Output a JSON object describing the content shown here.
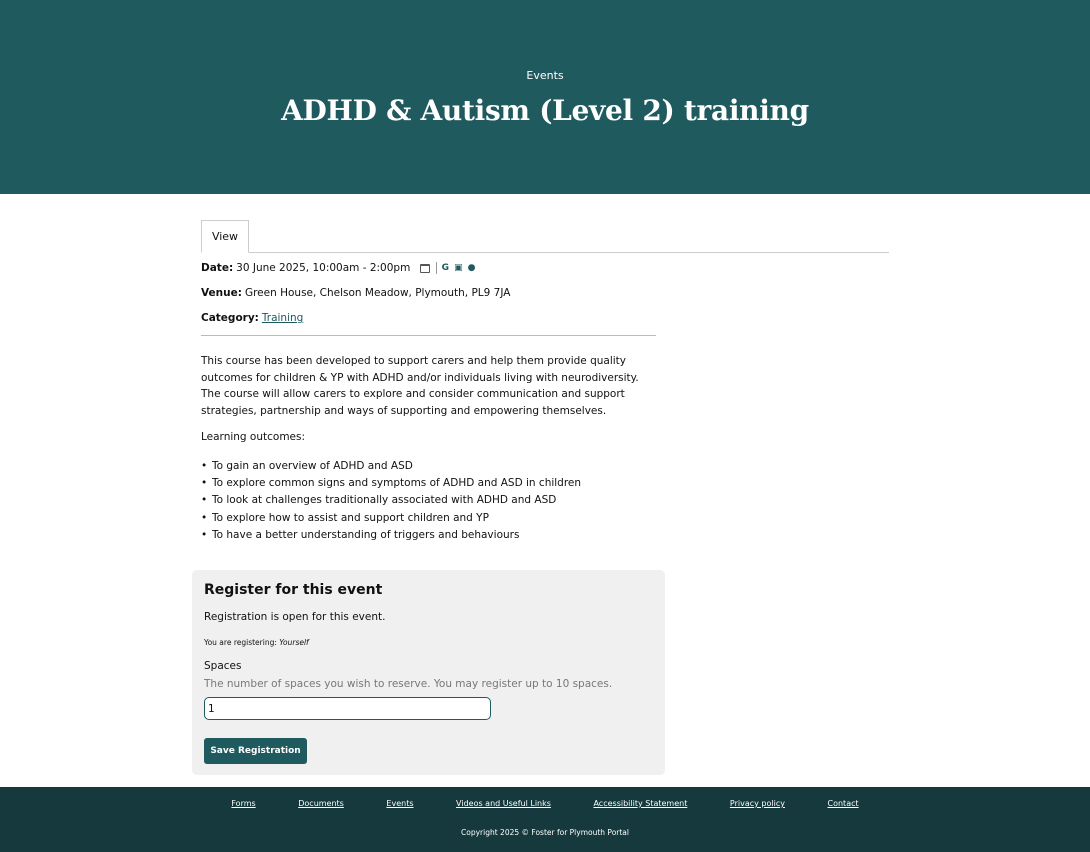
{
  "hero": {
    "eyebrow": "Events",
    "title": "ADHD & Autism (Level 2) training"
  },
  "tabs": [
    {
      "label": "View",
      "active": true
    }
  ],
  "event": {
    "date_label": "Date:",
    "date_value": "30 June 2025, 10:00am - 2:00pm",
    "calendar_icons": [
      "add-to-calendar-icon",
      "google-icon",
      "outlook-icon",
      "apple-icon"
    ],
    "venue_label": "Venue:",
    "venue_value": "Green House, Chelson Meadow, Plymouth, PL9 7JA",
    "category_label": "Category:",
    "category_value": "Training"
  },
  "body": {
    "description": "This course has been developed to support carers and help them provide quality outcomes for children & YP with ADHD and/or individuals living with neurodiversity. The course will allow carers to explore and consider communication and support strategies, partnership and ways of supporting and empowering themselves.",
    "outcomes_heading": "Learning outcomes:",
    "outcomes": [
      "To gain an overview of ADHD and ASD",
      "To explore common signs and symptoms of ADHD and ASD in children",
      "To look at challenges traditionally associated with ADHD and ASD",
      "To explore how to assist and support children and YP",
      "To have a better understanding of triggers and behaviours"
    ]
  },
  "registration": {
    "heading": "Register for this event",
    "status": "Registration is open for this event.",
    "registering_label": "You are registering:",
    "registering_value": "Yourself",
    "spaces_label": "Spaces",
    "spaces_hint": "The number of spaces you wish to reserve. You may register up to 10 spaces.",
    "spaces_value": "1",
    "save_label": "Save Registration"
  },
  "footer": {
    "links": [
      "Forms",
      "Documents",
      "Events",
      "Videos and Useful Links",
      "Accessibility Statement",
      "Privacy policy",
      "Contact"
    ],
    "copyright": "Copyright 2025 © Foster for Plymouth Portal"
  },
  "colors": {
    "hero_bg": "#1f5a5e",
    "footer_bg": "#15393c",
    "accent": "#1f5a5e",
    "panel_bg": "#f0f0f0"
  }
}
